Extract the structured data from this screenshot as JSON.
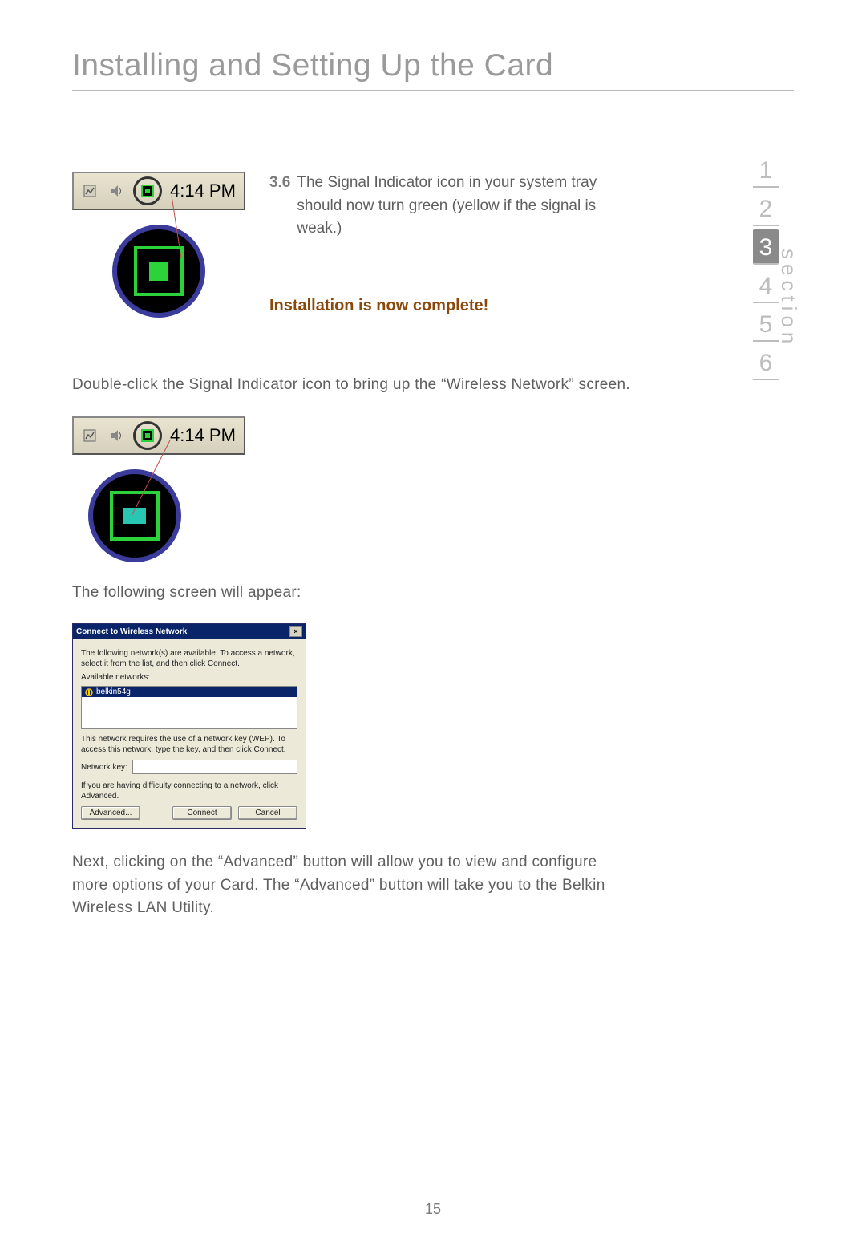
{
  "title": "Installing and Setting Up the Card",
  "nav": {
    "section_label": "section",
    "items": [
      "1",
      "2",
      "3",
      "4",
      "5",
      "6"
    ],
    "active_index": 2
  },
  "step": {
    "num": "3.6",
    "text": "The Signal Indicator icon in your system tray should now turn green (yellow if the signal is weak.)"
  },
  "complete": "Installation is now complete!",
  "tray_time": "4:14 PM",
  "para_doubleclick": "Double-click the Signal Indicator icon to bring up the “Wireless Network” screen.",
  "para_following": "The following screen will appear:",
  "dialog": {
    "title": "Connect to Wireless Network",
    "intro": "The following network(s) are available. To access a network, select it from the list, and then click Connect.",
    "available_label": "Available networks:",
    "network_item": "belkin54g",
    "wep_text": "This network requires the use of a network key (WEP). To access this network, type the key, and then click Connect.",
    "key_label": "Network key:",
    "advanced_hint": "If you are having difficulty connecting to a network, click Advanced.",
    "btn_advanced": "Advanced...",
    "btn_connect": "Connect",
    "btn_cancel": "Cancel"
  },
  "para_next": "Next, clicking  on the “Advanced” button will allow you to view and configure more options of your Card. The “Advanced” button will take you to the Belkin Wireless LAN Utility.",
  "page_number": "15"
}
